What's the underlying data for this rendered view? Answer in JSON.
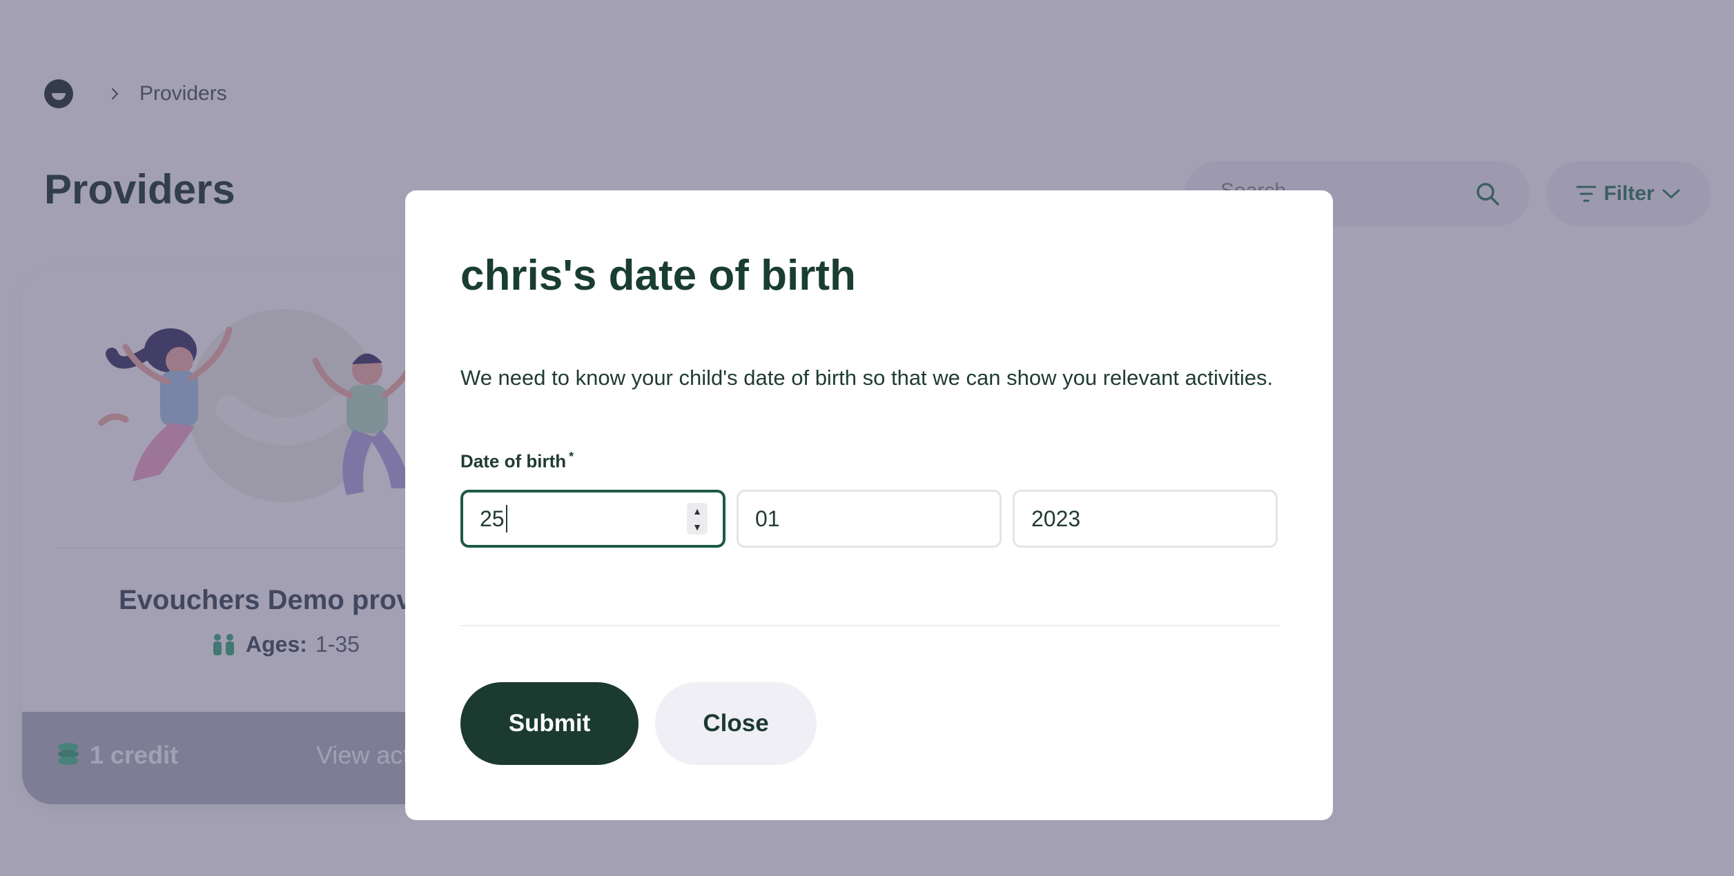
{
  "breadcrumb": {
    "current": "Providers"
  },
  "page": {
    "title": "Providers"
  },
  "search": {
    "placeholder": "Search"
  },
  "filter": {
    "label": "Filter"
  },
  "card": {
    "title": "Evouchers Demo provider",
    "ages_label": "Ages:",
    "ages_value": "1-35",
    "credit": "1 credit",
    "view_link": "View activities"
  },
  "modal": {
    "title": "chris's date of birth",
    "description": "We need to know your child's date of birth so that we can show you relevant activities.",
    "dob_label": "Date of birth",
    "required_mark": "*",
    "day": "25",
    "month": "01",
    "year": "2023",
    "submit_label": "Submit",
    "close_label": "Close"
  },
  "colors": {
    "brand_dark": "#1b3a30",
    "accent_green": "#2e7d5b",
    "overlay": "#484268"
  },
  "icons": {
    "logo": "smile-logo-icon",
    "breadcrumb_sep": "chevron-right-icon",
    "search": "search-icon",
    "filter": "filter-icon",
    "filter_chevron": "chevron-down-icon",
    "ages": "children-icon",
    "credit": "coins-icon",
    "stepper_up": "caret-up-icon",
    "stepper_down": "caret-down-icon"
  }
}
